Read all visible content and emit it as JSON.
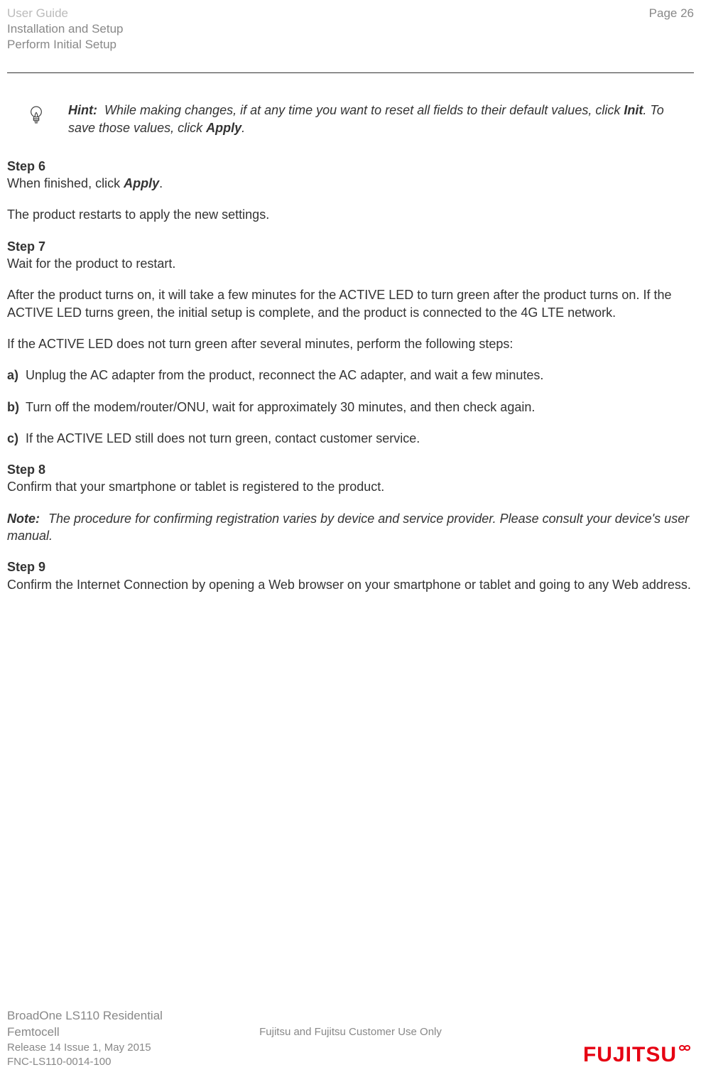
{
  "header": {
    "line1": "User Guide",
    "line2": "Installation and Setup",
    "line3": "Perform Initial Setup",
    "page": "Page 26"
  },
  "hint": {
    "label": "Hint:",
    "text_before": "While making changes, if at any time you want to reset all fields to their default values, click ",
    "bold1": "Init",
    "text_mid": ". To save those values, click ",
    "bold2": "Apply",
    "text_after": "."
  },
  "step6": {
    "label": "Step 6",
    "line_before": "When finished, click ",
    "line_bold": "Apply",
    "line_after": ".",
    "para2": "The product restarts to apply the new settings."
  },
  "step7": {
    "label": "Step 7",
    "line1": "Wait for the product to restart.",
    "para2": "After the product turns on, it will take a few minutes for the ACTIVE LED to turn green after the product turns on. If the ACTIVE LED turns green, the initial setup is complete, and the product is connected to the 4G LTE network.",
    "para3": "If the ACTIVE LED does not turn green after several minutes, perform the following steps:",
    "items": [
      {
        "marker": "a)",
        "text": "Unplug the AC adapter from the product, reconnect the AC adapter, and wait a few minutes."
      },
      {
        "marker": "b)",
        "text": "Turn off the modem/router/ONU, wait for approximately 30 minutes, and then check again."
      },
      {
        "marker": "c)",
        "text": "If the ACTIVE LED still does not turn green, contact customer service."
      }
    ]
  },
  "step8": {
    "label": "Step 8",
    "line1": "Confirm that your smartphone or tablet is registered to the product."
  },
  "note": {
    "label": "Note:",
    "text": "The procedure for confirming registration varies by device and service provider. Please consult your device's user manual."
  },
  "step9": {
    "label": "Step 9",
    "line1": "Confirm the Internet Connection by opening a Web browser on your smartphone or tablet and going to any Web address."
  },
  "footer": {
    "product1": "BroadOne LS110 Residential",
    "product2": "Femtocell",
    "release": "Release 14 Issue 1, May 2015",
    "docnum": "FNC-LS110-0014-100",
    "center": "Fujitsu and Fujitsu Customer Use Only",
    "logo_text": "FUJITSU"
  }
}
